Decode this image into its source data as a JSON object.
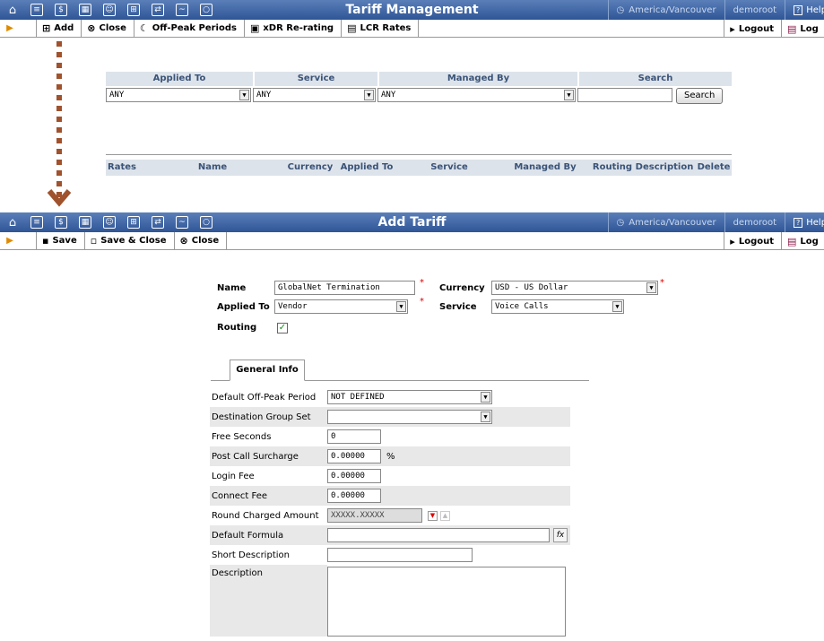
{
  "top": {
    "title": "Tariff Management",
    "timezone": "America/Vancouver",
    "user": "demoroot",
    "help": "Help",
    "toolbar": {
      "add": "Add",
      "close": "Close",
      "offpeak": "Off-Peak Periods",
      "xdr": "xDR Re-rating",
      "lcr": "LCR Rates",
      "logout": "Logout",
      "log": "Log"
    },
    "filters": {
      "headers": [
        "Applied To",
        "Service",
        "Managed By",
        "Search"
      ],
      "applied_to": "ANY",
      "service": "ANY",
      "managed_by": "ANY",
      "search_value": "",
      "search_button": "Search"
    },
    "table_headers": [
      "Rates",
      "Name",
      "Currency",
      "Applied To",
      "Service",
      "Managed By",
      "Routing",
      "Description",
      "Delete"
    ]
  },
  "bottom": {
    "title": "Add Tariff",
    "timezone": "America/Vancouver",
    "user": "demoroot",
    "help": "Help",
    "toolbar": {
      "save": "Save",
      "save_close": "Save & Close",
      "close": "Close",
      "logout": "Logout",
      "log": "Log"
    },
    "form": {
      "name_label": "Name",
      "name_value": "GlobalNet Termination",
      "currency_label": "Currency",
      "currency_value": "USD - US Dollar",
      "applied_label": "Applied To",
      "applied_value": "Vendor",
      "service_label": "Service",
      "service_value": "Voice Calls",
      "routing_label": "Routing",
      "routing_checked": true
    },
    "tab": "General Info",
    "fields": {
      "offpeak_label": "Default Off-Peak Period",
      "offpeak_value": "NOT DEFINED",
      "destgroup_label": "Destination Group Set",
      "destgroup_value": "",
      "free_label": "Free Seconds",
      "free_value": "0",
      "surcharge_label": "Post Call Surcharge",
      "surcharge_value": "0.00000",
      "surcharge_unit": "%",
      "login_label": "Login Fee",
      "login_value": "0.00000",
      "connect_label": "Connect Fee",
      "connect_value": "0.00000",
      "round_label": "Round Charged Amount",
      "round_value": "XXXXX.XXXXX",
      "formula_label": "Default Formula",
      "formula_value": "",
      "short_label": "Short Description",
      "short_value": "",
      "desc_label": "Description",
      "desc_value": ""
    }
  }
}
